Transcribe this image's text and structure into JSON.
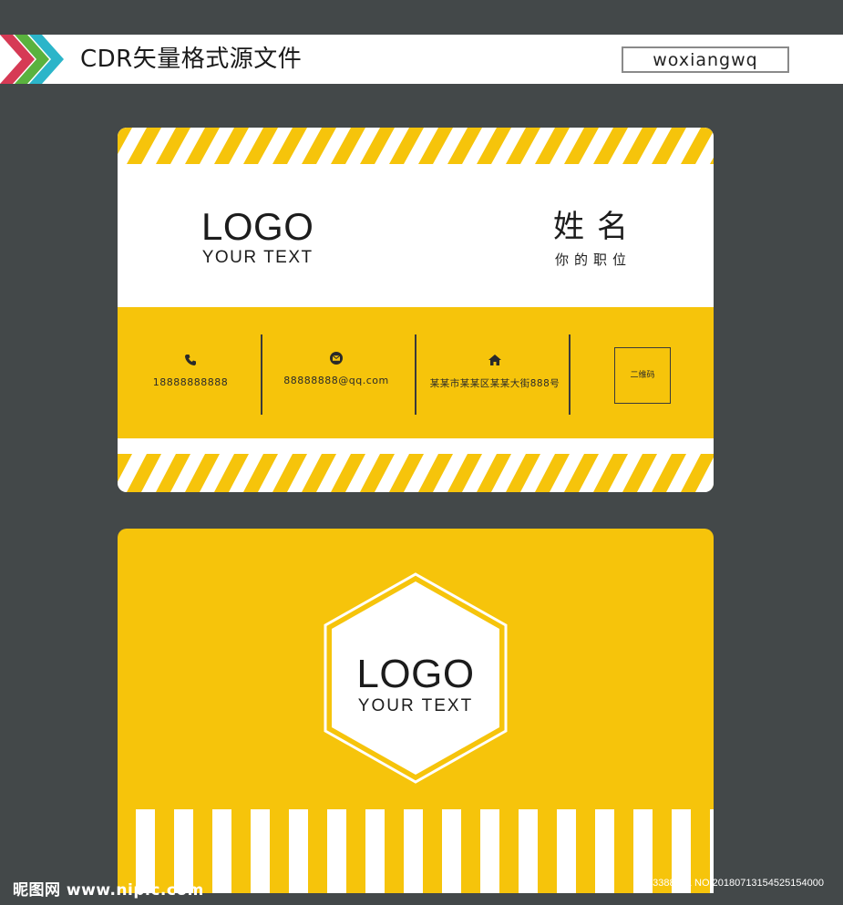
{
  "header": {
    "title": "CDR矢量格式源文件",
    "author": "woxiangwq"
  },
  "colors": {
    "background": "#434849",
    "accent_yellow": "#f6c40b",
    "chevron_red": "#d63a55",
    "chevron_green": "#5ab23e",
    "chevron_teal": "#2bb5c9"
  },
  "front_card": {
    "logo": "LOGO",
    "logo_sub": "YOUR TEXT",
    "name": "姓名",
    "position": "你的职位",
    "contacts": [
      {
        "icon": "phone-icon",
        "value": "18888888888"
      },
      {
        "icon": "mail-icon",
        "value": "88888888@qq.com"
      },
      {
        "icon": "home-icon",
        "value": "某某市某某区某某大街888号"
      }
    ],
    "qr_label": "二维码"
  },
  "back_card": {
    "logo": "LOGO",
    "logo_sub": "YOUR TEXT"
  },
  "footer": {
    "watermark": "昵图网 www.nipic.com",
    "image_id": "ID:13388861 NO:20180713154525154000"
  }
}
